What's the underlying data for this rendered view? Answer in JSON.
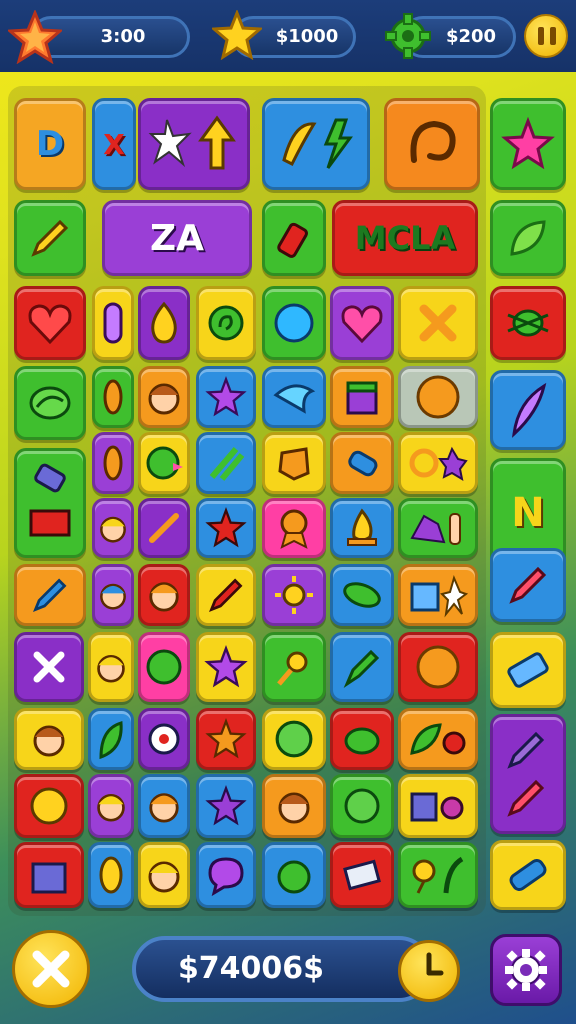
{
  "hud": {
    "timer": "3:00",
    "star_points": "$1000",
    "gear_points": "$200",
    "icons": {
      "timer": "star-icon",
      "stars": "star-icon",
      "gear": "green-gear-icon",
      "pause": "pause-icon"
    }
  },
  "board": {
    "word_tiles": [
      "D",
      "X",
      "ZA",
      "MCLA",
      "N"
    ]
  },
  "bottom": {
    "score": "$74006$",
    "icons": {
      "close": "close-icon",
      "clock": "clock-icon",
      "settings": "gear-icon"
    }
  },
  "colors": {
    "topbar": "#1c3d7a",
    "tile_yellow": "#f7d51a",
    "tile_orange": "#f59a1e",
    "tile_green": "#3fbf2e",
    "tile_purple": "#8a2fc7",
    "tile_blue": "#2e8fe0",
    "tile_red": "#e0241f"
  }
}
